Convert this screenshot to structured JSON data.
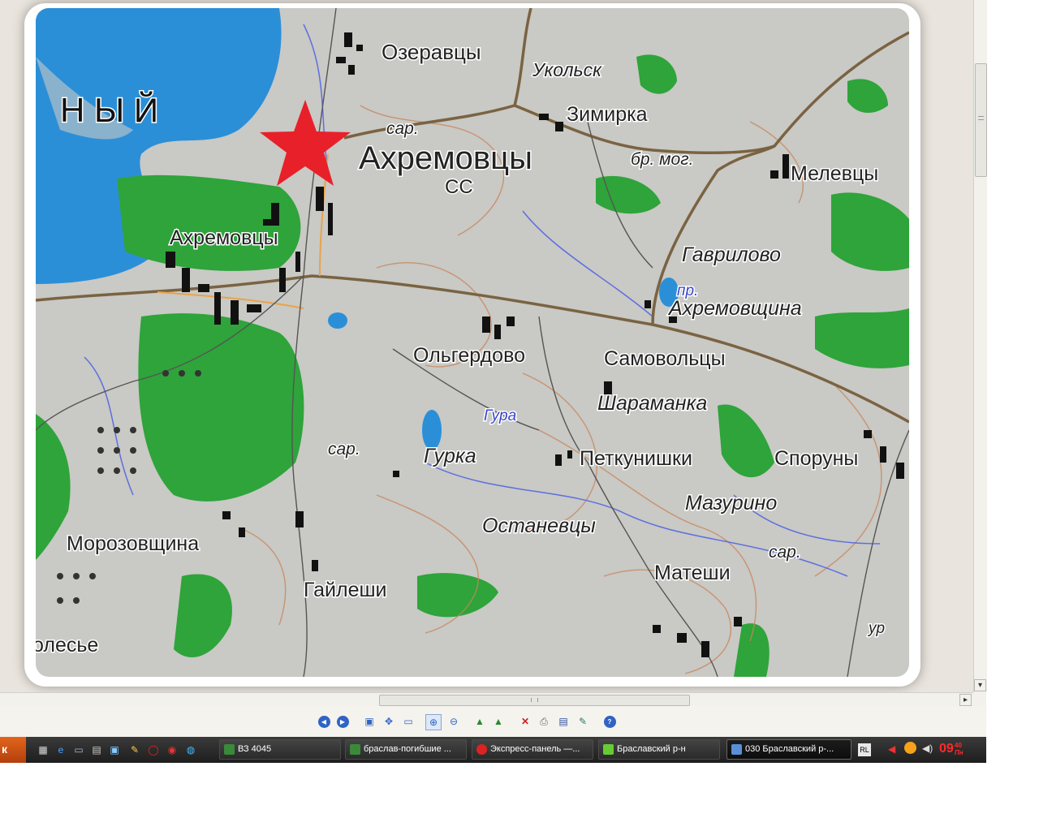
{
  "map": {
    "lake_label": "Н Ы Й",
    "main_place": "Ахремовцы",
    "main_place_sub": "СС",
    "places": [
      "Озеравцы",
      "Укольск",
      "Зимирка",
      "Мелевцы",
      "Ахремовцы",
      "Гаврилово",
      "Ахремовщина",
      "Ольгердово",
      "Самовольцы",
      "Шараманка",
      "Гурка",
      "Петкунишки",
      "Споруны",
      "Мазурино",
      "Останевцы",
      "Матеши",
      "Морозовщина",
      "Гайлеши",
      "олесье"
    ],
    "small_labels": [
      "сар.",
      "бр. мог.",
      "пр.",
      "Гура",
      "сар.",
      "сар.",
      "ур"
    ]
  },
  "scroll": {
    "down_arrow": "▾",
    "right_arrow": "▸"
  },
  "toolbar": {
    "icons": [
      "previous-icon",
      "next-icon",
      "fit-window-icon",
      "actual-size-icon",
      "slideshow-icon",
      "zoom-in-icon",
      "zoom-out-icon",
      "rotate-left-icon",
      "rotate-right-icon",
      "delete-icon",
      "print-icon",
      "save-icon",
      "edit-icon",
      "help-icon"
    ]
  },
  "taskbar": {
    "start_label": "к",
    "tasks": [
      {
        "label": "ВЗ 4045"
      },
      {
        "label": "браслав-погибшие ..."
      },
      {
        "label": "Экспресс-панель —..."
      },
      {
        "label": "Браславский р-н"
      },
      {
        "label": "030 Браславский р-..."
      }
    ],
    "lang": "RL",
    "clock": "09",
    "clock_small": "40",
    "clock_day": "Пн",
    "colors": {
      "clock": "#ff2a2a",
      "accent": "#e2651c"
    }
  }
}
